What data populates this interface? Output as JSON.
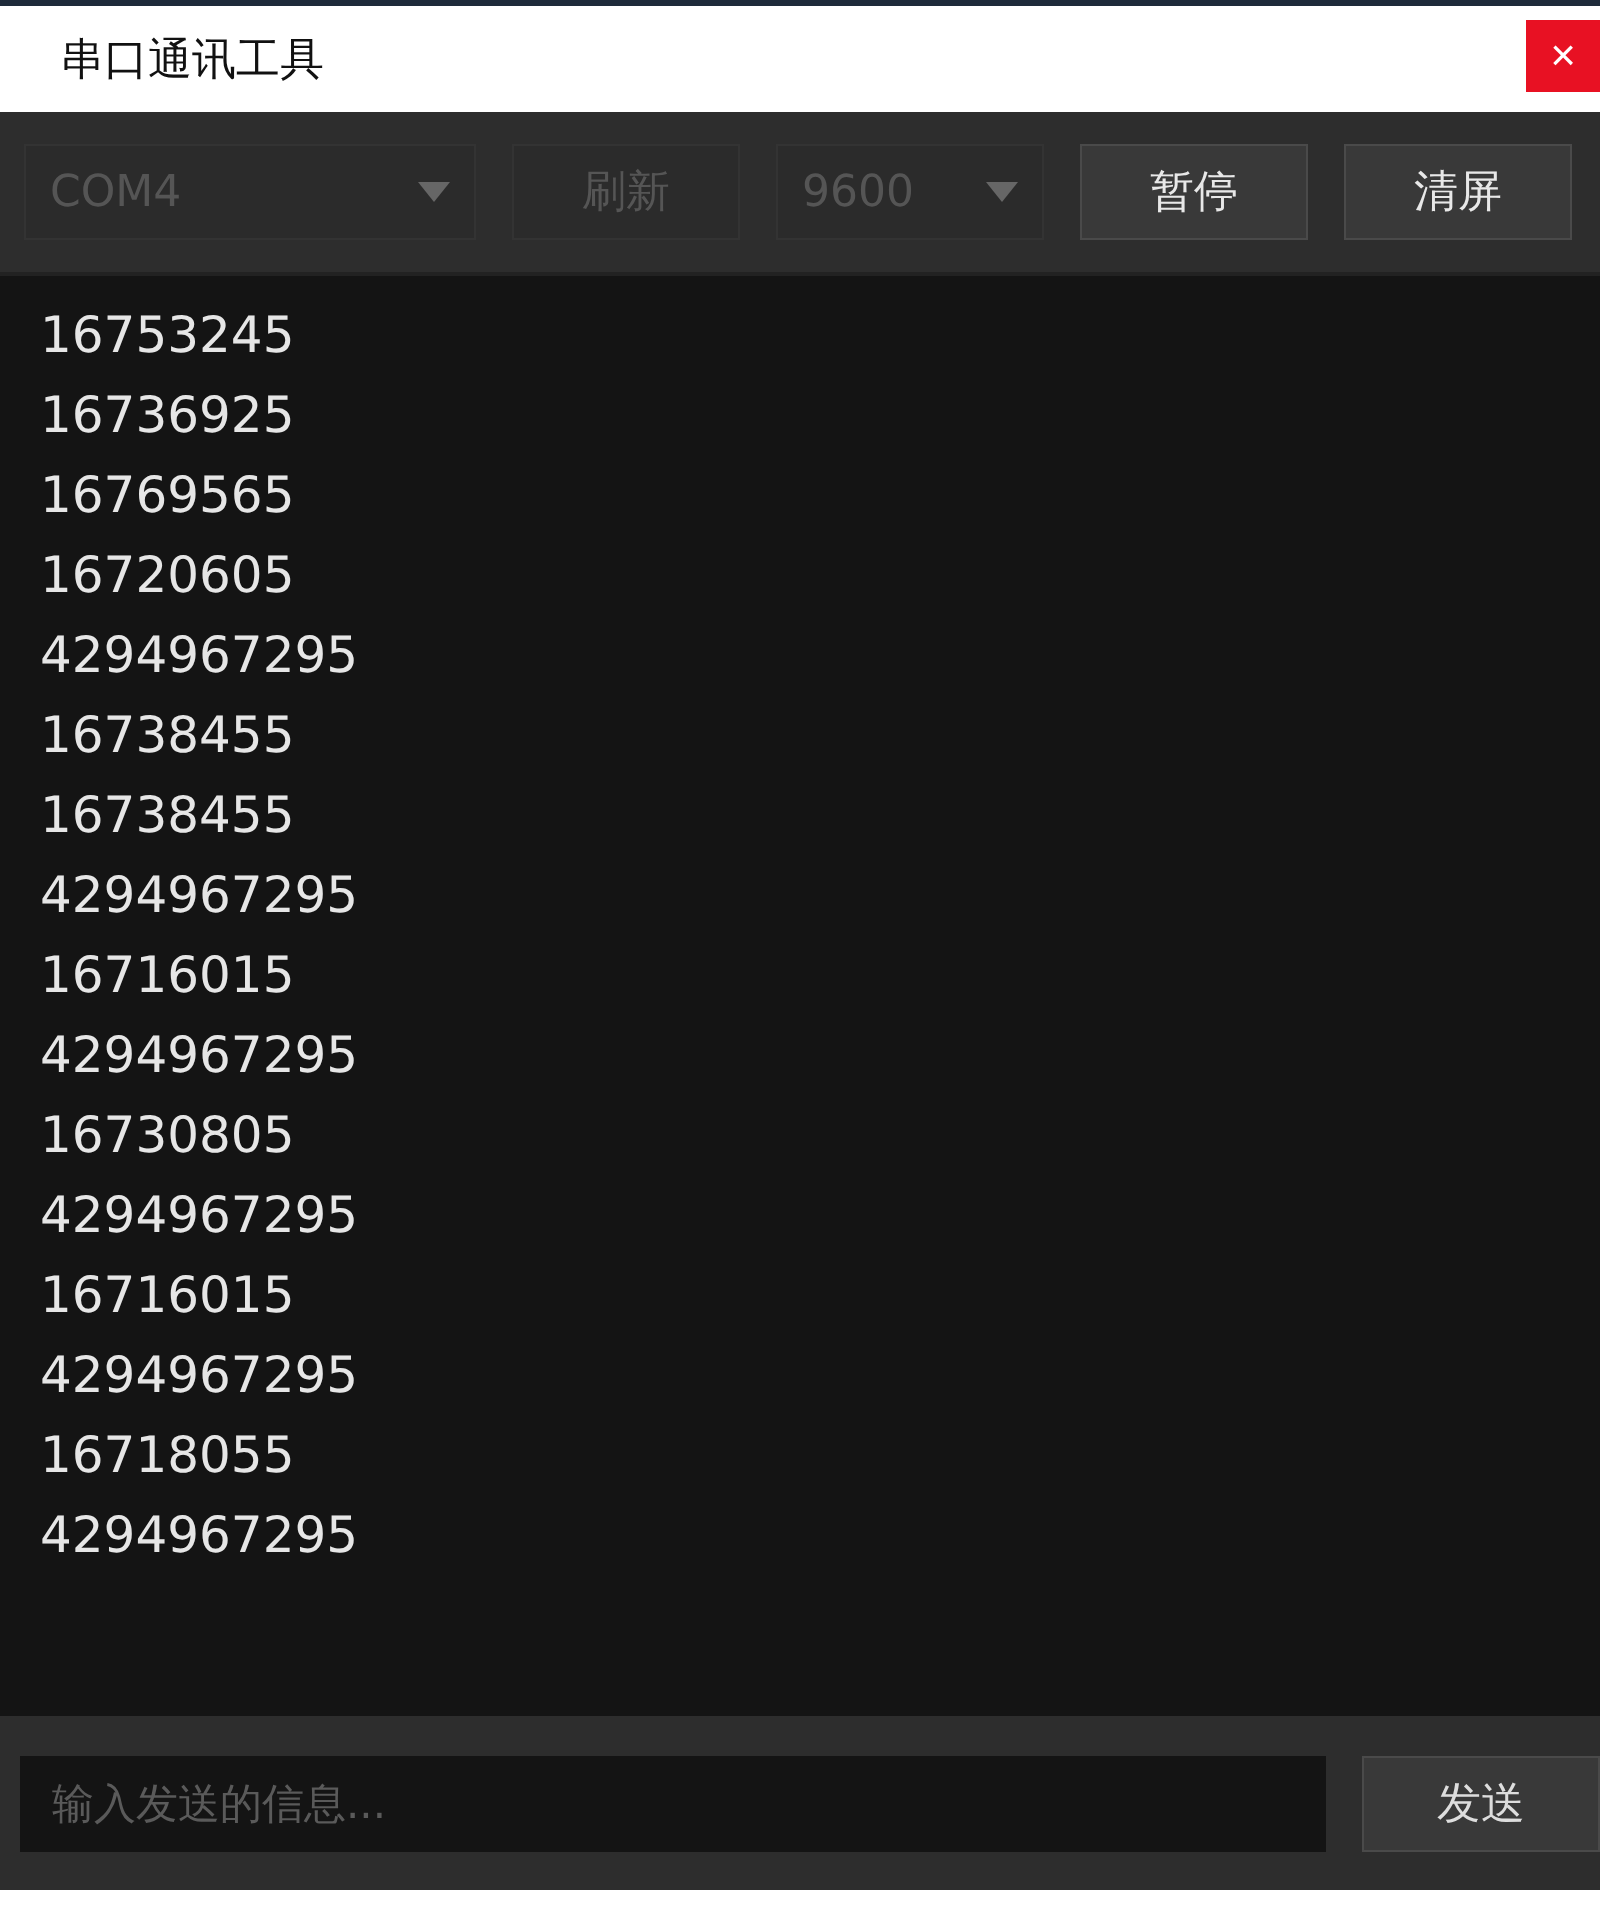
{
  "window": {
    "title": "串口通讯工具",
    "close": "×"
  },
  "toolbar": [
    {
      "kind": "select",
      "label": "COM4",
      "disabled": true
    },
    {
      "kind": "button",
      "label": "刷新",
      "disabled": true
    },
    {
      "kind": "select",
      "label": "9600",
      "disabled": true
    },
    {
      "kind": "button",
      "label": "暂停",
      "disabled": false
    },
    {
      "kind": "button",
      "label": "清屏",
      "disabled": false
    }
  ],
  "log_lines": [
    "16753245",
    "16736925",
    "16769565",
    "16720605",
    "4294967295",
    "16738455",
    "16738455",
    "4294967295",
    "16716015",
    "4294967295",
    "16730805",
    "4294967295",
    "16716015",
    "4294967295",
    "16718055",
    "4294967295"
  ],
  "send": {
    "placeholder": "输入发送的信息...",
    "button": "发送"
  }
}
